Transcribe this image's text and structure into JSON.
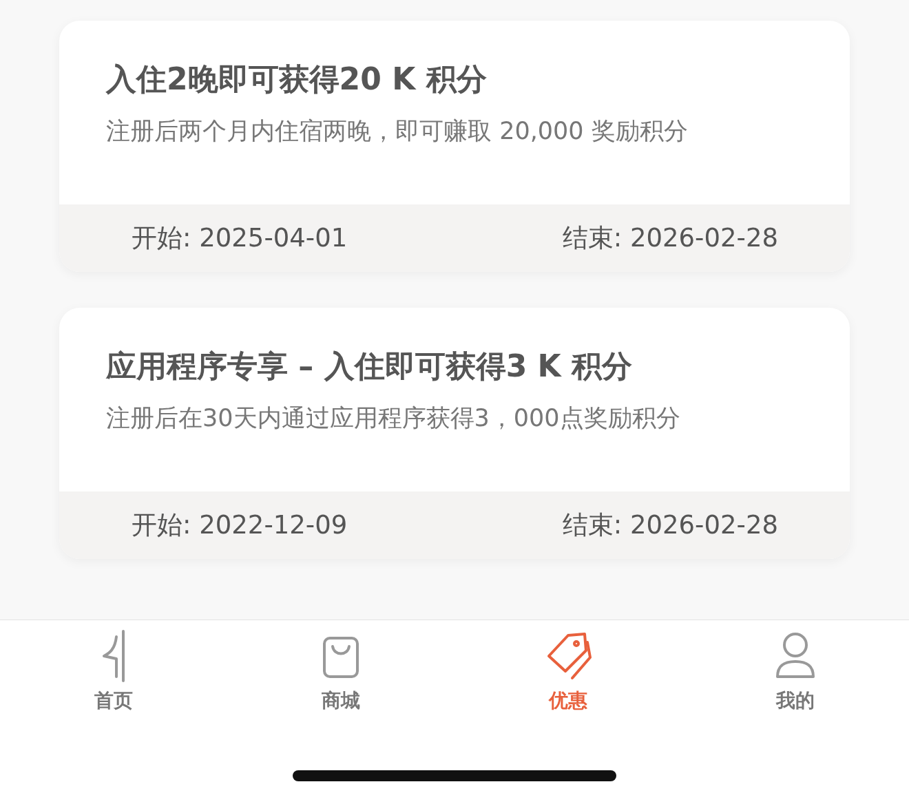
{
  "offers": [
    {
      "title": "入住2晚即可获得20 K 积分",
      "description": "注册后两个月内住宿两晚，即可赚取 20,000 奖励积分",
      "start": "开始: 2025-04-01",
      "end": "结束: 2026-02-28"
    },
    {
      "title": "应用程序专享 – 入住即可获得3 K 积分",
      "description": "注册后在30天内通过应用程序获得3，000点奖励积分",
      "start": "开始: 2022-12-09",
      "end": "结束: 2026-02-28"
    }
  ],
  "tab_bar": [
    {
      "kind": "home",
      "label": "首页",
      "selected": false
    },
    {
      "kind": "shop",
      "label": "商城",
      "selected": false
    },
    {
      "kind": "offers",
      "label": "优惠",
      "selected": true
    },
    {
      "kind": "profile",
      "label": "我的",
      "selected": false
    }
  ]
}
